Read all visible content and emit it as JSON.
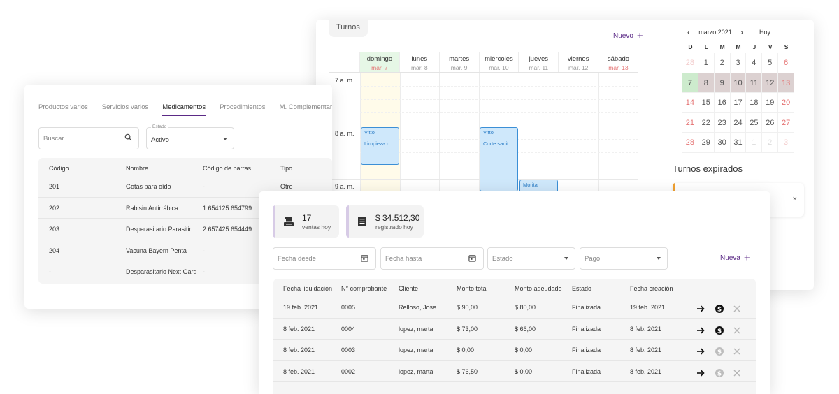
{
  "calendar": {
    "tab_label": "Turnos",
    "new_label": "Nuevo",
    "days": [
      {
        "name": "domingo",
        "date": "mar. 7"
      },
      {
        "name": "lunes",
        "date": "mar. 8"
      },
      {
        "name": "martes",
        "date": "mar. 9"
      },
      {
        "name": "miércoles",
        "date": "mar. 10"
      },
      {
        "name": "jueves",
        "date": "mar. 11"
      },
      {
        "name": "viernes",
        "date": "mar. 12"
      },
      {
        "name": "sábado",
        "date": "mar. 13"
      }
    ],
    "hours": [
      "7 a. m.",
      "8 a. m.",
      "9 a. m."
    ],
    "events": [
      {
        "title": "Vitto",
        "subtitle": "Limpieza de..."
      },
      {
        "title": "Vitto",
        "subtitle": "Corte sanitar..."
      },
      {
        "title": "Morita",
        "subtitle": ""
      }
    ],
    "mini": {
      "month": "marzo 2021",
      "today_label": "Hoy",
      "weekday_letters": [
        "D",
        "L",
        "M",
        "M",
        "J",
        "V",
        "S"
      ],
      "weeks": [
        [
          "28",
          "1",
          "2",
          "3",
          "4",
          "5",
          "6"
        ],
        [
          "7",
          "8",
          "9",
          "10",
          "11",
          "12",
          "13"
        ],
        [
          "14",
          "15",
          "16",
          "17",
          "18",
          "19",
          "20"
        ],
        [
          "21",
          "22",
          "23",
          "24",
          "25",
          "26",
          "27"
        ],
        [
          "28",
          "29",
          "30",
          "31",
          "1",
          "2",
          "3"
        ]
      ]
    },
    "expired_title": "Turnos expirados",
    "expired_close": "×"
  },
  "products": {
    "tabs": [
      "Productos varios",
      "Servicios varios",
      "Medicamentos",
      "Procedimientos",
      "M. Complementar"
    ],
    "active_tab": "Medicamentos",
    "search_placeholder": "Buscar",
    "status_label": "Estado",
    "status_value": "Activo",
    "headers": [
      "Código",
      "Nombre",
      "Código de barras",
      "Tipo"
    ],
    "rows": [
      {
        "code": "201",
        "name": "Gotas para oído",
        "barcode": "-",
        "type": "Otro"
      },
      {
        "code": "202",
        "name": "Rabisin Antirrábica",
        "barcode": "1 654125 654799",
        "type": ""
      },
      {
        "code": "203",
        "name": "Desparasitario Parasitin",
        "barcode": "2 657425 654449",
        "type": ""
      },
      {
        "code": "204",
        "name": "Vacuna Bayern Penta",
        "barcode": "-",
        "type": ""
      },
      {
        "code": "-",
        "name": "Desparasitario Next Gard",
        "barcode": "-",
        "type": ""
      }
    ]
  },
  "sales": {
    "stats": [
      {
        "value": "17",
        "label": "ventas hoy"
      },
      {
        "value": "$ 34.512,30",
        "label": "registrado hoy"
      }
    ],
    "filters": {
      "date_from": "Fecha desde",
      "date_to": "Fecha hasta",
      "status": "Estado",
      "payment": "Pago"
    },
    "new_label": "Nueva",
    "headers": [
      "Fecha liquidación",
      "N° comprobante",
      "Cliente",
      "Monto total",
      "Monto adeudado",
      "Estado",
      "Fecha creación"
    ],
    "rows": [
      {
        "date": "19 feb. 2021",
        "number": "0005",
        "client": "Relloso, Jose",
        "total": "$ 90,00",
        "due": "$ 80,00",
        "status": "Finalizada",
        "created": "19 feb. 2021",
        "pay_active": true
      },
      {
        "date": "8 feb. 2021",
        "number": "0004",
        "client": "lopez, marta",
        "total": "$ 73,00",
        "due": "$ 66,00",
        "status": "Finalizada",
        "created": "8 feb. 2021",
        "pay_active": true
      },
      {
        "date": "8 feb. 2021",
        "number": "0003",
        "client": "lopez, marta",
        "total": "$ 0,00",
        "due": "$ 0,00",
        "status": "Finalizada",
        "created": "8 feb. 2021",
        "pay_active": false
      },
      {
        "date": "8 feb. 2021",
        "number": "0002",
        "client": "lopez, marta",
        "total": "$ 76,50",
        "due": "$ 0,00",
        "status": "Finalizada",
        "created": "8 feb. 2021",
        "pay_active": false
      }
    ]
  }
}
